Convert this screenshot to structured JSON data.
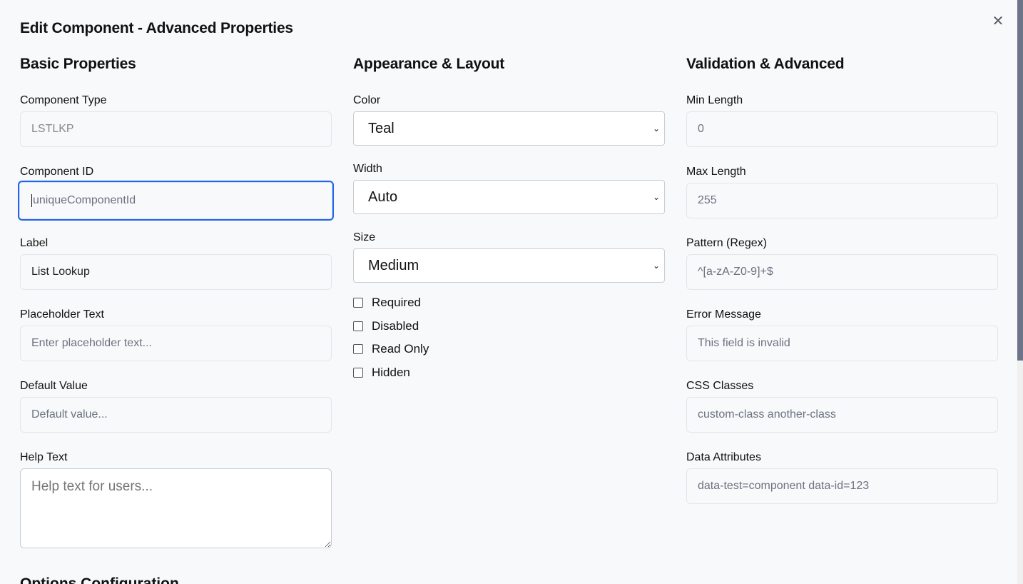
{
  "dialog": {
    "title": "Edit Component - Advanced Properties",
    "close_icon": "close-icon"
  },
  "basic": {
    "heading": "Basic Properties",
    "component_type": {
      "label": "Component Type",
      "value": "LSTLKP"
    },
    "component_id": {
      "label": "Component ID",
      "placeholder": "uniqueComponentId"
    },
    "label": {
      "label": "Label",
      "value": "List Lookup"
    },
    "placeholder_text": {
      "label": "Placeholder Text",
      "placeholder": "Enter placeholder text..."
    },
    "default_value": {
      "label": "Default Value",
      "placeholder": "Default value..."
    },
    "help_text": {
      "label": "Help Text",
      "placeholder": "Help text for users..."
    }
  },
  "appearance": {
    "heading": "Appearance & Layout",
    "color": {
      "label": "Color",
      "value": "Teal"
    },
    "width": {
      "label": "Width",
      "value": "Auto"
    },
    "size": {
      "label": "Size",
      "value": "Medium"
    },
    "checkboxes": [
      {
        "label": "Required",
        "checked": false
      },
      {
        "label": "Disabled",
        "checked": false
      },
      {
        "label": "Read Only",
        "checked": false
      },
      {
        "label": "Hidden",
        "checked": false
      }
    ]
  },
  "validation": {
    "heading": "Validation & Advanced",
    "min_length": {
      "label": "Min Length",
      "placeholder": "0"
    },
    "max_length": {
      "label": "Max Length",
      "placeholder": "255"
    },
    "pattern": {
      "label": "Pattern (Regex)",
      "placeholder": "^[a-zA-Z0-9]+$"
    },
    "error_message": {
      "label": "Error Message",
      "placeholder": "This field is invalid"
    },
    "css_classes": {
      "label": "CSS Classes",
      "placeholder": "custom-class another-class"
    },
    "data_attributes": {
      "label": "Data Attributes",
      "placeholder": "data-test=component data-id=123"
    }
  },
  "next_section": {
    "heading": "Options Configuration"
  },
  "colors": {
    "accent": "#2563eb",
    "background": "#f8f9fa"
  }
}
